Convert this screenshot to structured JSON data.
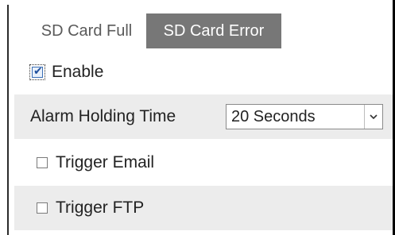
{
  "tabs": [
    {
      "label": "SD Card Full",
      "active": false
    },
    {
      "label": "SD Card Error",
      "active": true
    }
  ],
  "enable": {
    "label": "Enable",
    "checked": true
  },
  "alarm_holding_time": {
    "label": "Alarm Holding Time",
    "value": "20 Seconds"
  },
  "trigger_email": {
    "label": "Trigger Email",
    "checked": false
  },
  "trigger_ftp": {
    "label": "Trigger FTP",
    "checked": false
  },
  "icons": {
    "dropdown": "chevron-down-icon",
    "check": "check-icon"
  },
  "colors": {
    "active_tab_bg": "#777777",
    "row_shade": "#ececec"
  }
}
